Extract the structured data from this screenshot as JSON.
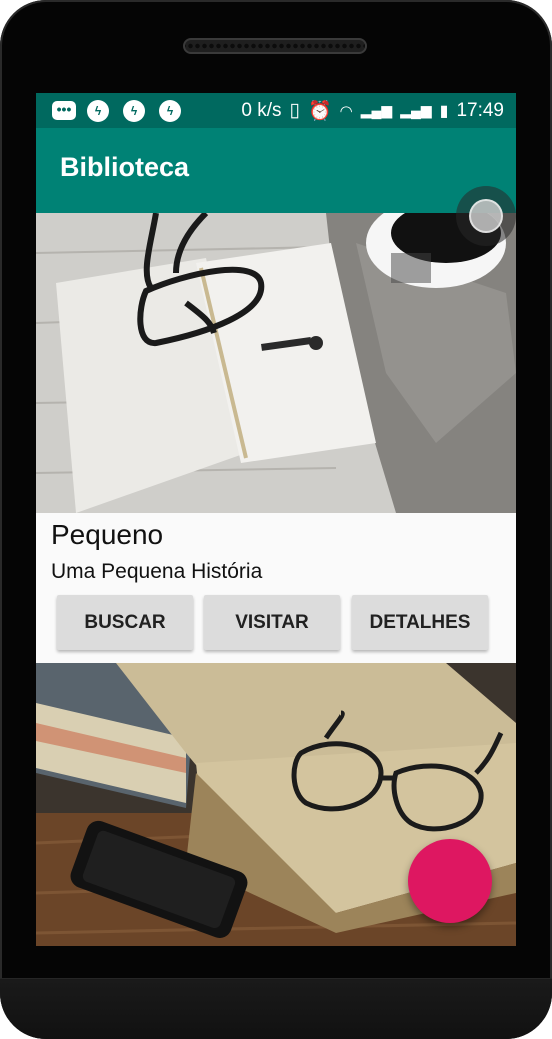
{
  "status_bar": {
    "speed": "0 k/s",
    "time": "17:49",
    "icons": [
      "message-icon",
      "messenger-icon",
      "messenger-icon",
      "messenger-icon",
      "vibrate-icon",
      "alarm-icon",
      "wifi-icon",
      "signal-icon",
      "signal-icon",
      "battery-charging-icon"
    ]
  },
  "app_bar": {
    "title": "Biblioteca",
    "color": "#008275"
  },
  "card": {
    "title": "Pequeno",
    "subtitle": "Uma Pequena História",
    "buttons": {
      "search": "BUSCAR",
      "visit": "VISITAR",
      "details": "DETALHES"
    }
  },
  "fab": {
    "color": "#de1761"
  }
}
